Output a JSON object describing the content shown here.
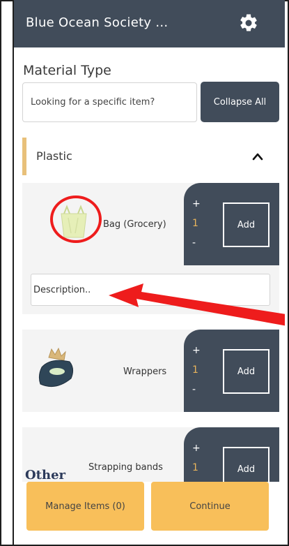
{
  "header": {
    "title": "Blue Ocean Society ...",
    "settings_icon": "gear-icon"
  },
  "material_type": {
    "label": "Material Type",
    "search_placeholder": "Looking for a specific item?",
    "collapse_all_label": "Collapse All"
  },
  "category": {
    "label": "Plastic",
    "expanded": true,
    "chevron_icon": "chevron-up-icon"
  },
  "items": [
    {
      "name": "Bag (Grocery)",
      "plus": "+",
      "quantity": "1",
      "minus": "-",
      "add_label": "Add",
      "description_placeholder": "Description..",
      "image_icon": "grocery-bag-icon"
    },
    {
      "name": "Wrappers",
      "plus": "+",
      "quantity": "1",
      "minus": "-",
      "add_label": "Add",
      "image_icon": "wrapper-icon"
    },
    {
      "name": "Strapping bands",
      "plus": "+",
      "quantity": "1",
      "add_label": "Add",
      "image_text": "Other"
    }
  ],
  "footer": {
    "manage_label": "Manage Items (0)",
    "continue_label": "Continue"
  },
  "colors": {
    "header": "#414c5a",
    "accent": "#f8bf5a",
    "quantity": "#e8b45c",
    "annotation": "#ee1c1c",
    "category_bar": "#e8c07a"
  }
}
